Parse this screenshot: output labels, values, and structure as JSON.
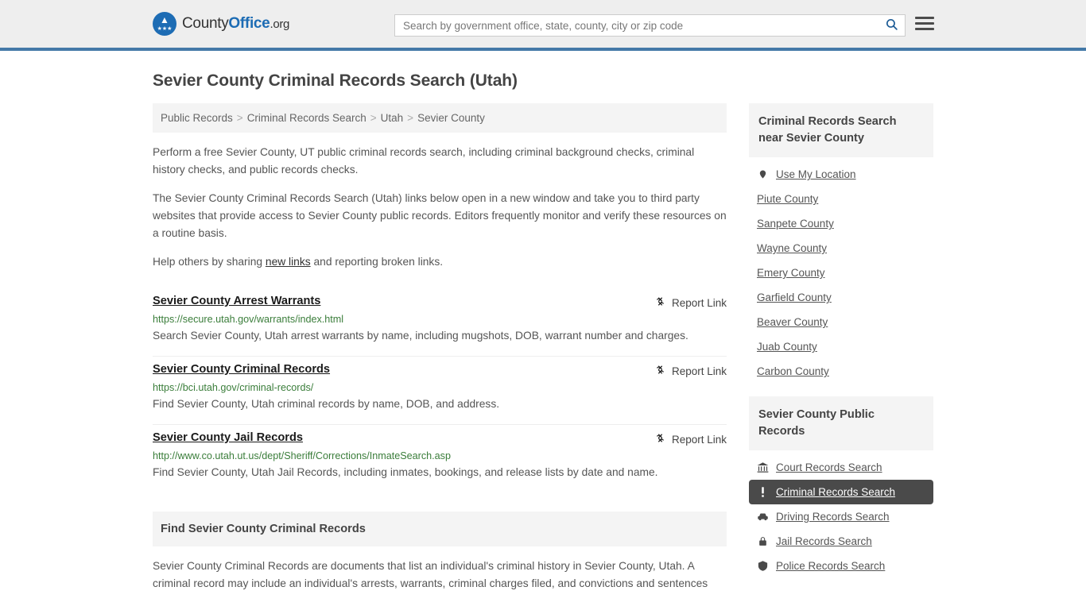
{
  "header": {
    "logo": {
      "part1": "County",
      "part2": "Office",
      "part3": ".org",
      "icon": "eagle-seal-icon"
    },
    "search": {
      "placeholder": "Search by government office, state, county, city or zip code",
      "value": "",
      "button_icon": "search-icon"
    },
    "menu_icon": "hamburger-menu-icon",
    "accent_color": "#4479a8"
  },
  "page": {
    "title": "Sevier County Criminal Records Search (Utah)"
  },
  "breadcrumb": {
    "items": [
      {
        "label": "Public Records"
      },
      {
        "label": "Criminal Records Search"
      },
      {
        "label": "Utah"
      },
      {
        "label": "Sevier County"
      }
    ],
    "separator": ">"
  },
  "intro": {
    "paragraphs": [
      "Perform a free Sevier County, UT public criminal records search, including criminal background checks, criminal history checks, and public records checks.",
      "The Sevier County Criminal Records Search (Utah) links below open in a new window and take you to third party websites that provide access to Sevier County public records. Editors frequently monitor and verify these resources on a routine basis."
    ],
    "share_prefix": "Help others by sharing ",
    "share_link": "new links",
    "share_suffix": " and reporting broken links."
  },
  "links": {
    "report_label": "Report Link",
    "report_icon": "broken-link-icon",
    "items": [
      {
        "title": "Sevier County Arrest Warrants",
        "url": "https://secure.utah.gov/warrants/index.html",
        "description": "Search Sevier County, Utah arrest warrants by name, including mugshots, DOB, warrant number and charges."
      },
      {
        "title": "Sevier County Criminal Records",
        "url": "https://bci.utah.gov/criminal-records/",
        "description": "Find Sevier County, Utah criminal records by name, DOB, and address."
      },
      {
        "title": "Sevier County Jail Records",
        "url": "http://www.co.utah.ut.us/dept/Sheriff/Corrections/InmateSearch.asp",
        "description": "Find Sevier County, Utah Jail Records, including inmates, bookings, and release lists by date and name."
      }
    ]
  },
  "section": {
    "heading": "Find Sevier County Criminal Records",
    "body": "Sevier County Criminal Records are documents that list an individual's criminal history in Sevier County, Utah. A criminal record may include an individual's arrests, warrants, criminal charges filed, and convictions and sentences"
  },
  "sidebar": {
    "nearby": {
      "heading": "Criminal Records Search near Sevier County",
      "items": [
        {
          "label": "Use My Location",
          "icon": "map-pin-icon"
        },
        {
          "label": "Piute County",
          "icon": ""
        },
        {
          "label": "Sanpete County",
          "icon": ""
        },
        {
          "label": "Wayne County",
          "icon": ""
        },
        {
          "label": "Emery County",
          "icon": ""
        },
        {
          "label": "Garfield County",
          "icon": ""
        },
        {
          "label": "Beaver County",
          "icon": ""
        },
        {
          "label": "Juab County",
          "icon": ""
        },
        {
          "label": "Carbon County",
          "icon": ""
        }
      ]
    },
    "public_records": {
      "heading": "Sevier County Public Records",
      "items": [
        {
          "label": "Court Records Search",
          "icon": "courthouse-icon",
          "active": false
        },
        {
          "label": "Criminal Records Search",
          "icon": "exclamation-icon",
          "active": true
        },
        {
          "label": "Driving Records Search",
          "icon": "car-icon",
          "active": false
        },
        {
          "label": "Jail Records Search",
          "icon": "lock-icon",
          "active": false
        },
        {
          "label": "Police Records Search",
          "icon": "police-badge-icon",
          "active": false
        }
      ]
    },
    "active_bg": "#4a4a4a"
  }
}
